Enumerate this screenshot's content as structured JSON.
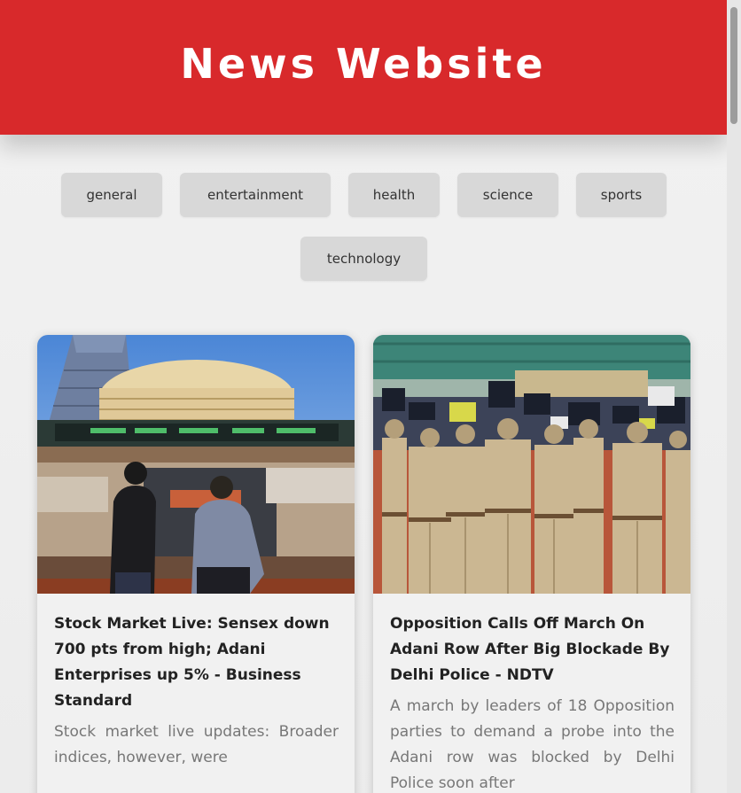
{
  "header": {
    "title": "News Website"
  },
  "categories": [
    {
      "label": "general"
    },
    {
      "label": "entertainment"
    },
    {
      "label": "health"
    },
    {
      "label": "science"
    },
    {
      "label": "sports"
    },
    {
      "label": "technology"
    }
  ],
  "articles": [
    {
      "title": "Stock Market Live: Sensex down 700 pts from high; Adani Enterprises up 5% - Business Standard",
      "description": "Stock market live updates: Broader indices, however, were",
      "image": "stock-exchange-photo"
    },
    {
      "title": "Opposition Calls Off March On Adani Row After Big Blockade By Delhi Police - NDTV",
      "description": "A march by leaders of 18 Opposition parties to demand a probe into the Adani row was blocked by Delhi Police soon after",
      "image": "police-blockade-photo"
    }
  ],
  "colors": {
    "accent": "#d8292b",
    "button_bg": "#d8d8d8",
    "page_bg": "#f0f0f0"
  }
}
